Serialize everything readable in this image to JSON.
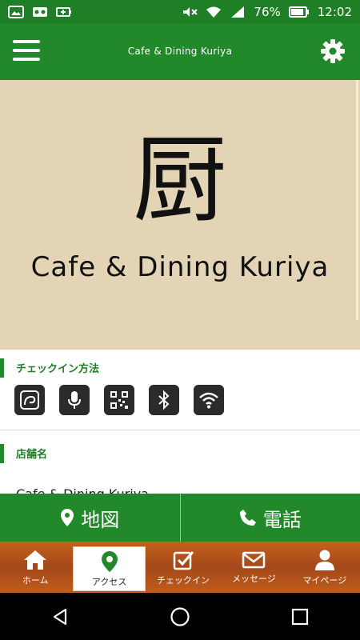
{
  "status_bar": {
    "battery_percent": "76%",
    "time": "12:02"
  },
  "app_bar": {
    "title": "Cafe & Dining Kuriya"
  },
  "hero": {
    "kanji": "厨",
    "name": "Cafe & Dining Kuriya"
  },
  "sections": {
    "checkin": {
      "title": "チェックイン方法",
      "icons": [
        "touch-icon",
        "microphone-icon",
        "qr-code-icon",
        "bluetooth-icon",
        "wifi-icon"
      ]
    },
    "store": {
      "title": "店舗名",
      "value": "Cafe & Dining Kuriya"
    }
  },
  "actions": {
    "map_label": "地図",
    "phone_label": "電話"
  },
  "tabs": [
    {
      "label": "ホーム",
      "icon": "home-icon",
      "active": false
    },
    {
      "label": "アクセス",
      "icon": "map-pin-icon",
      "active": true
    },
    {
      "label": "チェックイン",
      "icon": "checkbox-icon",
      "active": false
    },
    {
      "label": "メッセージ",
      "icon": "envelope-icon",
      "active": false
    },
    {
      "label": "マイページ",
      "icon": "user-icon",
      "active": false
    }
  ],
  "colors": {
    "primary": "#22892a",
    "accent_text": "#1f7f27",
    "hero_bg": "#e2d4b4",
    "tabbar_wood": "#b5521a"
  }
}
